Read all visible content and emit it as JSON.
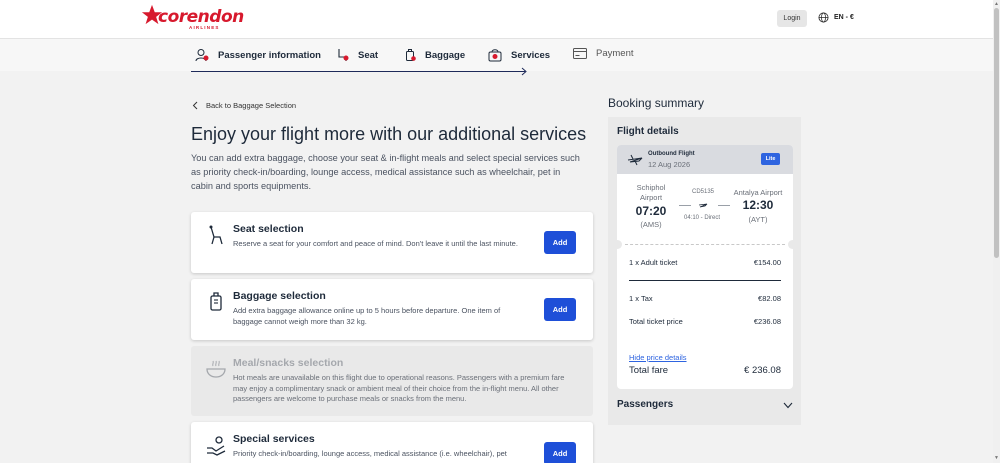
{
  "header": {
    "logo_text": "corendon",
    "logo_sub": "AIRLINES",
    "login_label": "Login",
    "language_label": "EN - €"
  },
  "steps": [
    {
      "label": "Passenger information",
      "icon": "passenger-icon"
    },
    {
      "label": "Seat",
      "icon": "seat-icon"
    },
    {
      "label": "Baggage",
      "icon": "baggage-icon"
    },
    {
      "label": "Services",
      "icon": "services-icon"
    },
    {
      "label": "Payment",
      "icon": "payment-icon"
    }
  ],
  "main": {
    "back_label": "Back to Baggage Selection",
    "title": "Enjoy your flight more with our additional services",
    "intro": "You can add extra baggage, choose your seat & in-flight meals and select special services such as priority check-in/boarding, lounge access, medical assistance such as wheelchair, pet in cabin and sports equipments.",
    "services": [
      {
        "title": "Seat selection",
        "desc": "Reserve a seat for your comfort and peace of mind. Don't leave it until the last minute.",
        "button": "Add",
        "icon": "seat-icon",
        "enabled": true
      },
      {
        "title": "Baggage selection",
        "desc": "Add extra baggage allowance online up to 5 hours before departure. One item of baggage cannot weigh more than 32 kg.",
        "button": "Add",
        "icon": "baggage-icon",
        "enabled": true
      },
      {
        "title": "Meal/snacks selection",
        "desc": "Hot meals are unavailable on this flight due to operational reasons. Passengers with a premium fare may enjoy a complimentary snack or ambient meal of their choice from the in-flight menu. All other passengers are welcome to purchase meals or snacks from the menu.",
        "button": "",
        "icon": "meal-icon",
        "enabled": false
      },
      {
        "title": "Special services",
        "desc": "Priority check-in/boarding, lounge access, medical assistance (i.e. wheelchair), pet",
        "button": "Add",
        "icon": "special-services-icon",
        "enabled": true
      }
    ]
  },
  "summary": {
    "title": "Booking summary",
    "flight_details_label": "Flight details",
    "flight": {
      "label": "Outbound Flight",
      "date": "12 Aug 2026",
      "fare_badge": "Lite",
      "origin_name": "Schiphol Airport",
      "origin_time": "07:20",
      "origin_code": "(AMS)",
      "dest_name": "Antalya Airport",
      "dest_time": "12:30",
      "dest_code": "(AYT)",
      "flight_number": "CD5135",
      "duration": "04:10 - Direct"
    },
    "prices": {
      "adult_label": "1 x Adult ticket",
      "adult_value": "€154.00",
      "tax_label": "1 x Tax",
      "tax_value": "€82.08",
      "total_ticket_label": "Total ticket price",
      "total_ticket_value": "€236.08",
      "hide_label": "Hide price details",
      "total_fare_label": "Total fare",
      "total_fare_value": "€ 236.08"
    },
    "passengers_label": "Passengers"
  },
  "colors": {
    "brand_red": "#d7192d",
    "accent_blue": "#1e4fd8",
    "text_dark": "#1e2a3a"
  }
}
